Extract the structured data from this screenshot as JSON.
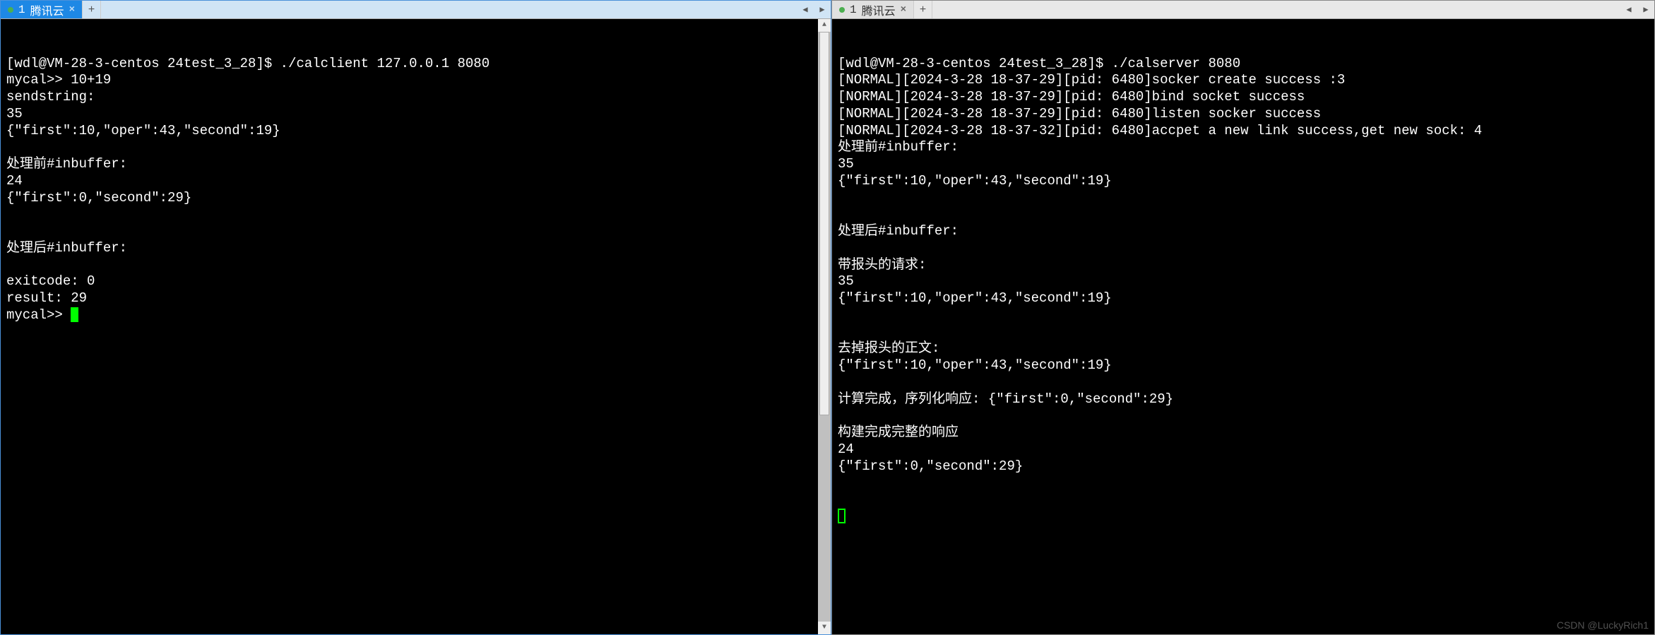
{
  "left": {
    "tab": {
      "index": "1",
      "title": "腾讯云"
    },
    "lines": [
      "[wdl@VM-28-3-centos 24test_3_28]$ ./calclient 127.0.0.1 8080",
      "mycal>> 10+19",
      "sendstring:",
      "35",
      "{\"first\":10,\"oper\":43,\"second\":19}",
      "",
      "处理前#inbuffer:",
      "24",
      "{\"first\":0,\"second\":29}",
      "",
      "",
      "处理后#inbuffer:",
      "",
      "exitcode: 0",
      "result: 29",
      "mycal>> "
    ]
  },
  "right": {
    "tab": {
      "index": "1",
      "title": "腾讯云"
    },
    "lines": [
      "[wdl@VM-28-3-centos 24test_3_28]$ ./calserver 8080",
      "[NORMAL][2024-3-28 18-37-29][pid: 6480]socker create success :3",
      "[NORMAL][2024-3-28 18-37-29][pid: 6480]bind socket success",
      "[NORMAL][2024-3-28 18-37-29][pid: 6480]listen socker success",
      "[NORMAL][2024-3-28 18-37-32][pid: 6480]accpet a new link success,get new sock: 4",
      "处理前#inbuffer:",
      "35",
      "{\"first\":10,\"oper\":43,\"second\":19}",
      "",
      "",
      "处理后#inbuffer:",
      "",
      "带报头的请求:",
      "35",
      "{\"first\":10,\"oper\":43,\"second\":19}",
      "",
      "",
      "去掉报头的正文:",
      "{\"first\":10,\"oper\":43,\"second\":19}",
      "",
      "计算完成，序列化响应: {\"first\":0,\"second\":29}",
      "",
      "构建完成完整的响应",
      "24",
      "{\"first\":0,\"second\":29}",
      "",
      ""
    ]
  },
  "watermark": "CSDN @LuckyRich1"
}
